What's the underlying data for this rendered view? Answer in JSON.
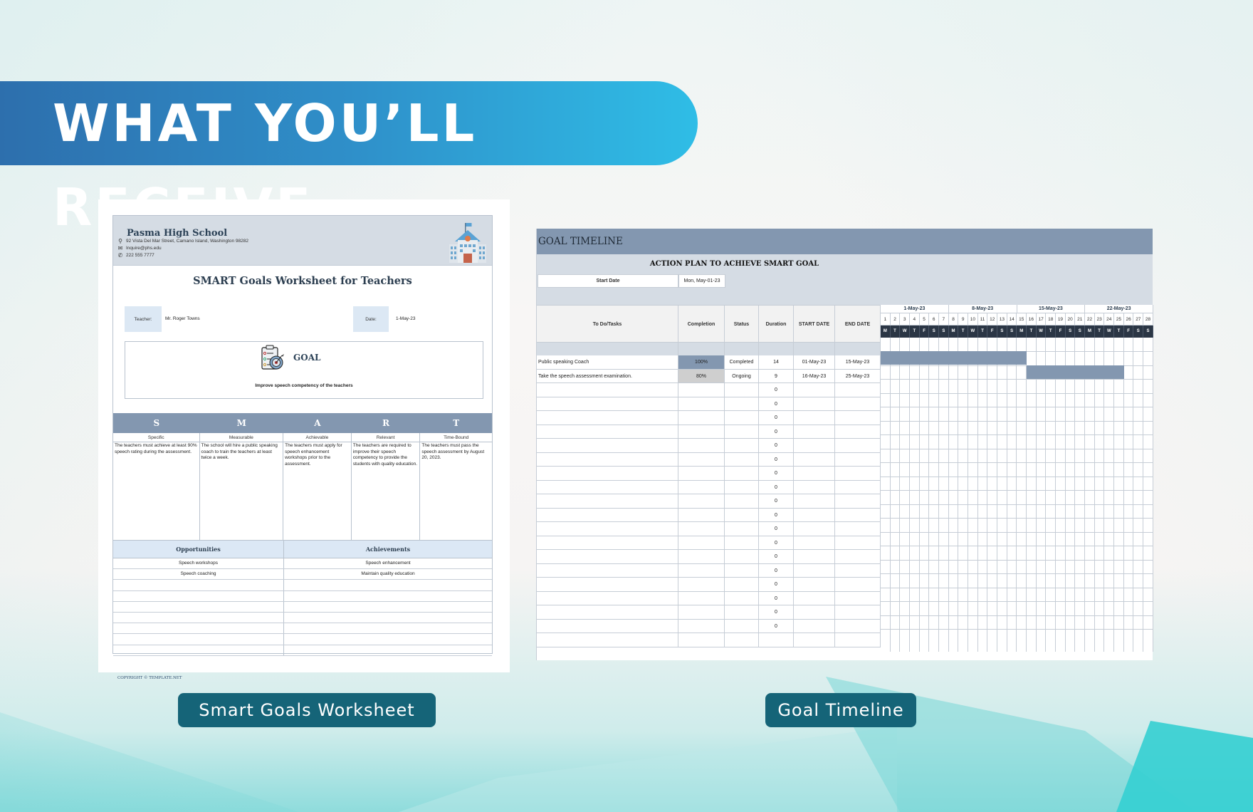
{
  "banner": {
    "title": "WHAT YOU’LL RECEIVE"
  },
  "worksheet": {
    "school_name": "Pasma High School",
    "address": "92 Vista Del Mar Street, Camano Island, Washington 98282",
    "email": "Inquire@phs.edu",
    "phone": "222 555 7777",
    "title": "SMART Goals Worksheet for Teachers",
    "teacher_label": "Teacher:",
    "teacher_value": "Mr. Roger Towns",
    "date_label": "Date:",
    "date_value": "1-May-23",
    "goal_label": "GOAL",
    "goal_text": "Improve speech competency of the teachers",
    "smart": [
      {
        "letter": "S",
        "name": "Specific",
        "text": "The teachers must achieve at least 90% speech rating during the assessment."
      },
      {
        "letter": "M",
        "name": "Measurable",
        "text": "The school will hire a public speaking coach to train the teachers at least twice a week."
      },
      {
        "letter": "A",
        "name": "Achievable",
        "text": "The teachers must apply for speech enhancement workshops prior to the assessment."
      },
      {
        "letter": "R",
        "name": "Relevant",
        "text": "The teachers are required to improve their speech competency to provide the students with quality education."
      },
      {
        "letter": "T",
        "name": "Time-Bound",
        "text": "The teachers must pass the speech assessment by August 20, 2023."
      }
    ],
    "opportunities_header": "Opportunities",
    "achievements_header": "Achievements",
    "rows": [
      {
        "opportunity": "Speech workshops",
        "achievement": "Speech enhancement"
      },
      {
        "opportunity": "Speech coaching",
        "achievement": "Maintain quality education"
      },
      {
        "opportunity": "",
        "achievement": ""
      },
      {
        "opportunity": "",
        "achievement": ""
      },
      {
        "opportunity": "",
        "achievement": ""
      },
      {
        "opportunity": "",
        "achievement": ""
      },
      {
        "opportunity": "",
        "achievement": ""
      },
      {
        "opportunity": "",
        "achievement": ""
      },
      {
        "opportunity": "",
        "achievement": ""
      }
    ],
    "copyright": "COPYRIGHT © TEMPLATE.NET"
  },
  "timeline": {
    "title": "GOAL TIMELINE",
    "subtitle": "ACTION PLAN TO ACHIEVE SMART GOAL",
    "start_date_label": "Start Date",
    "start_date_value": "Mon, May-01-23",
    "columns": [
      "To Do/Tasks",
      "Completion",
      "Status",
      "Duration",
      "START DATE",
      "END DATE"
    ],
    "weeks": [
      "1-May-23",
      "8-May-23",
      "15-May-23",
      "22-May-23"
    ],
    "days": [
      "1",
      "2",
      "3",
      "4",
      "5",
      "6",
      "7",
      "8",
      "9",
      "10",
      "11",
      "12",
      "13",
      "14",
      "15",
      "16",
      "17",
      "18",
      "19",
      "20",
      "21",
      "22",
      "23",
      "24",
      "25",
      "26",
      "27",
      "28"
    ],
    "day_of_week": [
      "M",
      "T",
      "W",
      "T",
      "F",
      "S",
      "S",
      "M",
      "T",
      "W",
      "T",
      "F",
      "S",
      "S",
      "M",
      "T",
      "W",
      "T",
      "F",
      "S",
      "S",
      "M",
      "T",
      "W",
      "T",
      "F",
      "S",
      "S"
    ],
    "tasks": [
      {
        "task": "Public speaking Coach",
        "completion": "100%",
        "status": "Completed",
        "duration": "14",
        "start": "01-May-23",
        "end": "15-May-23",
        "bar_start_day": 1,
        "bar_end_day": 15
      },
      {
        "task": "Take the speech assessment examination.",
        "completion": "80%",
        "status": "Ongoing",
        "duration": "9",
        "start": "16-May-23",
        "end": "25-May-23",
        "bar_start_day": 16,
        "bar_end_day": 25
      },
      {
        "task": "",
        "completion": "",
        "status": "",
        "duration": "0",
        "start": "",
        "end": ""
      },
      {
        "task": "",
        "completion": "",
        "status": "",
        "duration": "0",
        "start": "",
        "end": ""
      },
      {
        "task": "",
        "completion": "",
        "status": "",
        "duration": "0",
        "start": "",
        "end": ""
      },
      {
        "task": "",
        "completion": "",
        "status": "",
        "duration": "0",
        "start": "",
        "end": ""
      },
      {
        "task": "",
        "completion": "",
        "status": "",
        "duration": "0",
        "start": "",
        "end": ""
      },
      {
        "task": "",
        "completion": "",
        "status": "",
        "duration": "0",
        "start": "",
        "end": ""
      },
      {
        "task": "",
        "completion": "",
        "status": "",
        "duration": "0",
        "start": "",
        "end": ""
      },
      {
        "task": "",
        "completion": "",
        "status": "",
        "duration": "0",
        "start": "",
        "end": ""
      },
      {
        "task": "",
        "completion": "",
        "status": "",
        "duration": "0",
        "start": "",
        "end": ""
      },
      {
        "task": "",
        "completion": "",
        "status": "",
        "duration": "0",
        "start": "",
        "end": ""
      },
      {
        "task": "",
        "completion": "",
        "status": "",
        "duration": "0",
        "start": "",
        "end": ""
      },
      {
        "task": "",
        "completion": "",
        "status": "",
        "duration": "0",
        "start": "",
        "end": ""
      },
      {
        "task": "",
        "completion": "",
        "status": "",
        "duration": "0",
        "start": "",
        "end": ""
      },
      {
        "task": "",
        "completion": "",
        "status": "",
        "duration": "0",
        "start": "",
        "end": ""
      },
      {
        "task": "",
        "completion": "",
        "status": "",
        "duration": "0",
        "start": "",
        "end": ""
      },
      {
        "task": "",
        "completion": "",
        "status": "",
        "duration": "0",
        "start": "",
        "end": ""
      },
      {
        "task": "",
        "completion": "",
        "status": "",
        "duration": "0",
        "start": "",
        "end": ""
      },
      {
        "task": "",
        "completion": "",
        "status": "",
        "duration": "0",
        "start": "",
        "end": ""
      },
      {
        "task": "",
        "completion": "",
        "status": "",
        "duration": "",
        "start": "",
        "end": ""
      }
    ]
  },
  "labels": {
    "worksheet": "Smart Goals Worksheet",
    "timeline": "Goal Timeline"
  },
  "colors": {
    "banner_start": "#2d6fad",
    "banner_end": "#2fbde6",
    "label_bg": "#156478",
    "sheet_accent": "#8397b0",
    "sheet_header": "#d5dce4",
    "calendar_dark": "#2b3645"
  }
}
